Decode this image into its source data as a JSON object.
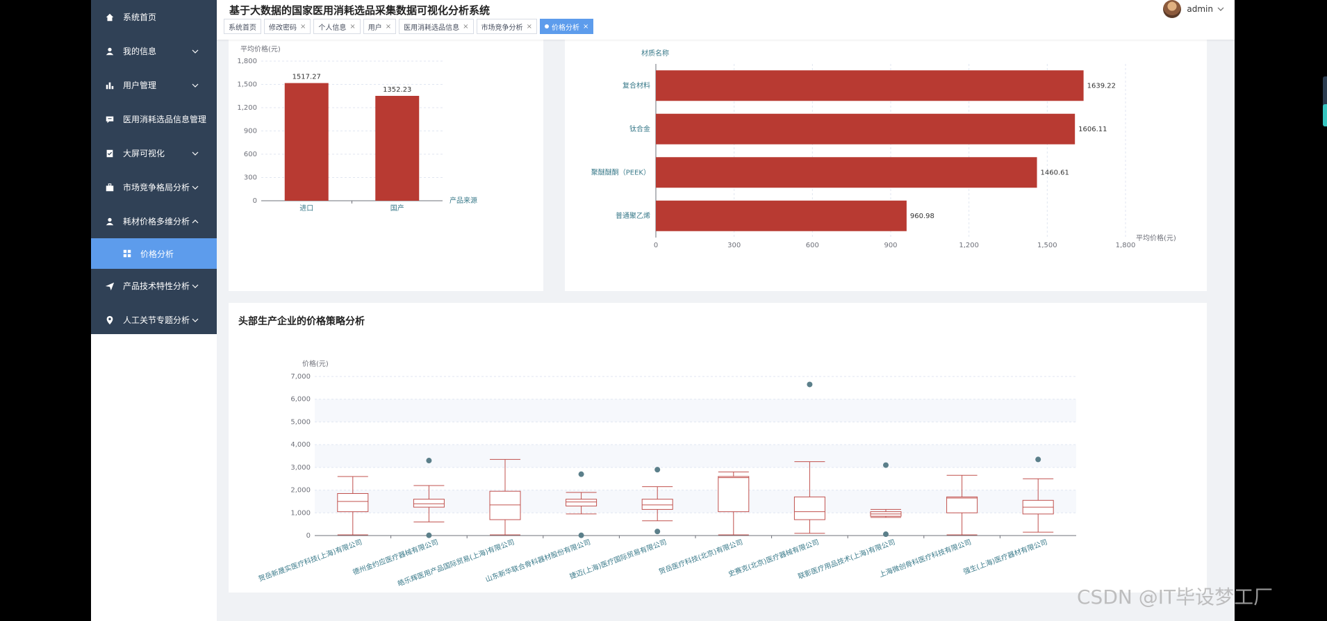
{
  "app": {
    "title": "基于大数据的国家医用消耗选品采集数据可视化分析系统",
    "user": "admin"
  },
  "sidebar": {
    "items": [
      {
        "label": "系统首页",
        "icon": "home-icon",
        "chevron": false
      },
      {
        "label": "我的信息",
        "icon": "user-icon",
        "chevron": true
      },
      {
        "label": "用户管理",
        "icon": "bar-chart-icon",
        "chevron": true
      },
      {
        "label": "医用消耗选品信息管理",
        "icon": "comment-icon",
        "chevron": false
      },
      {
        "label": "大屏可视化",
        "icon": "clipboard-check-icon",
        "chevron": true
      },
      {
        "label": "市场竞争格局分析",
        "icon": "briefcase-icon",
        "chevron": true
      },
      {
        "label": "耗材价格多维分析",
        "icon": "user-icon",
        "chevron": true,
        "expanded": true
      }
    ],
    "active_sub": {
      "label": "价格分析",
      "icon": "grid-icon"
    },
    "items_after": [
      {
        "label": "产品技术特性分析",
        "icon": "send-icon",
        "chevron": true
      },
      {
        "label": "人工关节专题分析",
        "icon": "map-pin-icon",
        "chevron": true
      }
    ]
  },
  "tabs": [
    {
      "label": "系统首页",
      "closable": false
    },
    {
      "label": "修改密码",
      "closable": true
    },
    {
      "label": "个人信息",
      "closable": true
    },
    {
      "label": "用户",
      "closable": true
    },
    {
      "label": "医用消耗选品信息",
      "closable": true
    },
    {
      "label": "市场竞争分析",
      "closable": true
    },
    {
      "label": "价格分析",
      "closable": true,
      "active": true
    }
  ],
  "chart_data": [
    {
      "type": "bar",
      "ylabel": "平均价格(元)",
      "xlabel": "产品来源",
      "categories": [
        "进口",
        "国产"
      ],
      "values": [
        1517.27,
        1352.23
      ],
      "ylim": [
        0,
        1800
      ],
      "yticks": [
        0,
        300,
        600,
        900,
        1200,
        1500,
        1800
      ],
      "ytick_labels": [
        "0",
        "300",
        "600",
        "900",
        "1,200",
        "1,500",
        "1,800"
      ],
      "color": "#b83a32",
      "grid": true
    },
    {
      "type": "bar",
      "orientation": "horizontal",
      "ylabel": "材质名称",
      "xlabel": "平均价格(元)",
      "categories": [
        "复合材料",
        "钛合金",
        "聚醚醚酮（PEEK）",
        "普通聚乙烯"
      ],
      "values": [
        1639.22,
        1606.11,
        1460.61,
        960.98
      ],
      "xlim": [
        0,
        1800
      ],
      "xticks": [
        0,
        300,
        600,
        900,
        1200,
        1500,
        1800
      ],
      "xtick_labels": [
        "0",
        "300",
        "600",
        "900",
        "1,200",
        "1,500",
        "1,800"
      ],
      "color": "#b83a32",
      "grid": true
    },
    {
      "type": "box",
      "title": "头部生产企业的价格策略分析",
      "ylabel": "价格(元)",
      "ylim": [
        0,
        7000
      ],
      "yticks": [
        0,
        1000,
        2000,
        3000,
        4000,
        5000,
        6000,
        7000
      ],
      "ytick_labels": [
        "0",
        "1,000",
        "2,000",
        "3,000",
        "4,000",
        "5,000",
        "6,000",
        "7,000"
      ],
      "categories": [
        "贺岳新晟实医疗科技(上海)有限公司",
        "德州金约应医疗器械有限公司",
        "皓乐辉医用产品国际贸易(上海)有限公司",
        "山东新华联合骨科器材股份有限公司",
        "捷迈(上海)医疗国际贸易有限公司",
        "贺岳医疗科技(北京)有限公司",
        "史赛克(北京)医疗器械有限公司",
        "联影医疗用品技术(上海)有限公司",
        "上海微创骨科医疗科技有限公司",
        "强生(上海)医疗器材有限公司"
      ],
      "boxes": [
        {
          "min": 30,
          "q1": 1050,
          "median": 1500,
          "q3": 1850,
          "max": 2600
        },
        {
          "min": 600,
          "q1": 1250,
          "median": 1400,
          "q3": 1600,
          "max": 2200
        },
        {
          "min": 30,
          "q1": 700,
          "median": 1350,
          "q3": 1950,
          "max": 3350
        },
        {
          "min": 950,
          "q1": 1300,
          "median": 1480,
          "q3": 1600,
          "max": 1900
        },
        {
          "min": 650,
          "q1": 1150,
          "median": 1350,
          "q3": 1600,
          "max": 2150
        },
        {
          "min": 30,
          "q1": 1050,
          "median": 2550,
          "q3": 2600,
          "max": 2800
        },
        {
          "min": 100,
          "q1": 700,
          "median": 1050,
          "q3": 1700,
          "max": 3250
        },
        {
          "min": 800,
          "q1": 850,
          "median": 950,
          "q3": 1050,
          "max": 1150
        },
        {
          "min": 30,
          "q1": 1000,
          "median": 1650,
          "q3": 1700,
          "max": 2650
        },
        {
          "min": 150,
          "q1": 950,
          "median": 1250,
          "q3": 1550,
          "max": 2500
        }
      ],
      "outliers": [
        {
          "index": 1,
          "values": [
            3300,
            10
          ]
        },
        {
          "index": 3,
          "values": [
            2700,
            10
          ]
        },
        {
          "index": 4,
          "values": [
            2900,
            180
          ]
        },
        {
          "index": 6,
          "values": [
            6650
          ]
        },
        {
          "index": 7,
          "values": [
            3100,
            60
          ]
        },
        {
          "index": 9,
          "values": [
            3350
          ]
        }
      ],
      "box_color": "#c0504d",
      "outlier_color": "#5b7f8a",
      "grid": true
    }
  ],
  "watermark": "CSDN @IT毕设梦工厂"
}
